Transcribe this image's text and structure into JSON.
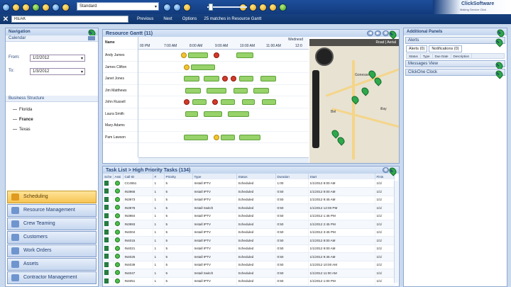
{
  "toolbar": {
    "view_select": "Standard"
  },
  "searchbar": {
    "search_value": "REAK",
    "previous_label": "Previous",
    "next_label": "Next",
    "options_label": "Options",
    "matches_text": "25 matches in Resource Gantt"
  },
  "logo": {
    "title": "ClickSoftware",
    "tagline": "Making Service Click"
  },
  "navigation": {
    "title": "Navigation",
    "calendar_label": "Calendar",
    "from_label": "From:",
    "from_value": "1/2/2012",
    "to_label": "To:",
    "to_value": "1/3/2012",
    "business_structure_label": "Business Structure",
    "tree": [
      "Florida",
      "France",
      "Texas"
    ],
    "modules": [
      "Scheduling",
      "Resource Management",
      "Crew Teaming",
      "Customers",
      "Work Orders",
      "Assets",
      "Contractor Management"
    ]
  },
  "gantt": {
    "title": "Resource Gantt (11)",
    "day_label": "Wednesd",
    "hours": [
      "00 PM",
      "7:00 AM",
      "8:00 AM",
      "9:00 AM",
      "10:00 AM",
      "11:00 AM",
      "12:0"
    ],
    "resources": [
      "Andy James",
      "James Clifton",
      "Janet Jones",
      "Jim Matthews",
      "John Russell",
      "Laura Smith",
      "Mary Adams",
      "Pam Lawson"
    ],
    "map_labels": [
      "Road",
      "Aerial"
    ],
    "map_places": [
      "Gonesse",
      "Bel",
      "illay"
    ]
  },
  "tasklist": {
    "title": "Task List > High Priority Tasks (134)",
    "columns": [
      "Sche",
      "Assi",
      "Call ID",
      "#",
      "Priority",
      "Type",
      "Status",
      "Duration",
      "Start",
      "Finis"
    ],
    "rows": [
      [
        "CC4551",
        "1",
        "5",
        "Install IPTV",
        "Scheduled",
        "1:00",
        "1/1/2012 8:00 AM",
        "1/1/"
      ],
      [
        "IN3966",
        "1",
        "5",
        "Install IPTV",
        "Scheduled",
        "0:50",
        "1/1/2012 9:00 AM",
        "1/1/"
      ],
      [
        "IN3973",
        "1",
        "5",
        "Install IPTV",
        "Scheduled",
        "0:50",
        "1/1/2012 9:45 AM",
        "1/1/"
      ],
      [
        "IN3978",
        "1",
        "5",
        "Install Switch",
        "Scheduled",
        "0:50",
        "1/1/2012 12:00 PM",
        "1/1/"
      ],
      [
        "IN3984",
        "1",
        "5",
        "Install IPTV",
        "Scheduled",
        "0:50",
        "1/1/2012 1:46 PM",
        "1/1/"
      ],
      [
        "IN3993",
        "1",
        "5",
        "Install IPTV",
        "Scheduled",
        "0:50",
        "1/1/2012 2:45 PM",
        "1/1/"
      ],
      [
        "IN4004",
        "1",
        "5",
        "Install IPTV",
        "Scheduled",
        "0:50",
        "1/1/2012 3:45 PM",
        "1/1/"
      ],
      [
        "IN4015",
        "1",
        "5",
        "Install IPTV",
        "Scheduled",
        "0:50",
        "1/1/2012 8:00 AM",
        "1/1/"
      ],
      [
        "IN4021",
        "1",
        "5",
        "Install IPTV",
        "Scheduled",
        "0:50",
        "1/1/2012 9:00 AM",
        "1/1/"
      ],
      [
        "IN4025",
        "1",
        "5",
        "Install IPTV",
        "Scheduled",
        "0:50",
        "1/1/2012 9:45 AM",
        "1/1/"
      ],
      [
        "IN4039",
        "1",
        "5",
        "Install IPTV",
        "Scheduled",
        "0:50",
        "1/1/2012 10:00 AM",
        "1/1/"
      ],
      [
        "IN4047",
        "1",
        "5",
        "Install Switch",
        "Scheduled",
        "0:50",
        "1/1/2012 11:00 AM",
        "1/1/"
      ],
      [
        "IN4051",
        "1",
        "5",
        "Install IPTV",
        "Scheduled",
        "0:50",
        "1/1/2012 1:00 PM",
        "1/1/"
      ]
    ]
  },
  "additional_panels": {
    "title": "Additional Panels",
    "alerts_label": "Alerts",
    "alerts_tab": "Alerts (0)",
    "notifications_tab": "Notifications (0)",
    "alert_columns": [
      "Status",
      "Type",
      "Due Date",
      "Description"
    ],
    "messages_label": "Messages View",
    "clickone_label": "ClickOne Clock"
  }
}
